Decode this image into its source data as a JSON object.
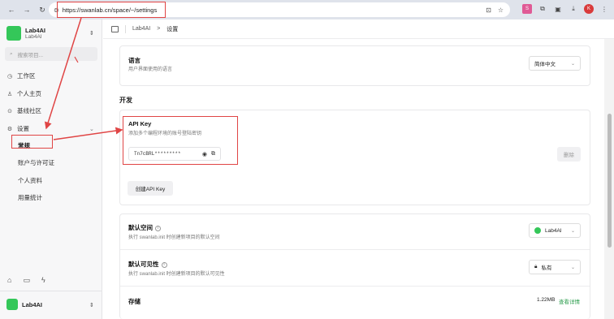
{
  "browser": {
    "url": "https://swanlab.cn/space/~/settings",
    "ext_pink": "S",
    "avatar_letter": "K"
  },
  "sidebar": {
    "workspace_title": "Lab4AI",
    "workspace_sub": "Lab4AI",
    "search_placeholder": "搜索项目...",
    "items": [
      {
        "label": "工作区"
      },
      {
        "label": "个人主页"
      },
      {
        "label": "基线社区"
      },
      {
        "label": "设置"
      }
    ],
    "sub_items": [
      {
        "label": "常规"
      },
      {
        "label": "账户与许可证"
      },
      {
        "label": "个人资料"
      },
      {
        "label": "用量统计"
      }
    ],
    "bottom_workspace": "Lab4AI"
  },
  "topbar": {
    "crumb1": "Lab4AI",
    "crumb_sep": ">",
    "crumb2": "设置"
  },
  "language": {
    "title": "语言",
    "desc": "用户界面使用的语言",
    "value": "简体中文"
  },
  "dev": {
    "section": "开发",
    "api_title": "API Key",
    "api_desc": "添加多个编程环境的账号登陆密钥",
    "key_value": "Tn7cBRL*********",
    "delete_label": "删除",
    "create_label": "创建API Key"
  },
  "default_space": {
    "title": "默认空间",
    "desc": "执行 swanlab.init 时创建新项目的默认空间",
    "value": "Lab4AI"
  },
  "default_visibility": {
    "title": "默认可见性",
    "desc": "执行 swanlab.init 时创建新项目的默认可见性",
    "value": "私有"
  },
  "storage": {
    "title": "存储",
    "value": "1.22MB",
    "link": "查看详情"
  },
  "colors": {
    "accent_green": "#34c759",
    "annotation_red": "#e04545"
  }
}
